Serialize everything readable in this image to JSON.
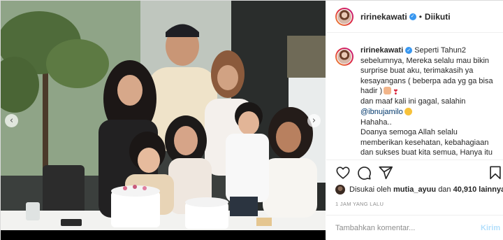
{
  "header": {
    "username": "ririnekawati",
    "separator": "•",
    "follow_status": "Diikuti"
  },
  "caption": {
    "username": "ririnekawati",
    "lines": [
      "Seperti Tahun2",
      "sebelumnya, Mereka selalu mau bikin",
      "surprise buat aku, terimakasih ya",
      "kesayangans ( beberpa ada yg ga bisa",
      "hadir )",
      "dan maaf kali ini gagal, salahin",
      "@ibnujamilo",
      "Hahaha..",
      "Doanya semoga Allah selalu",
      "memberikan kesehatan, kebahagiaan",
      "dan sukses buat kita semua, Hanya itu"
    ]
  },
  "likes": {
    "prefix": "Disukai oleh",
    "user": "mutia_ayuu",
    "connector": "dan",
    "count": "40,910 lainnya"
  },
  "timestamp": "1 JAM YANG LALU",
  "comment": {
    "placeholder": "Tambahkan komentar...",
    "post_label": "Kirim"
  },
  "icons": {
    "prev": "chevron-left-icon",
    "next": "chevron-right-icon",
    "like": "heart-icon",
    "comment": "comment-icon",
    "share": "paper-plane-icon",
    "save": "bookmark-icon",
    "verified": "verified-badge-icon"
  },
  "colors": {
    "verified": "#3897f0",
    "mention": "#00376b",
    "muted": "#8e8e8e",
    "post_button": "#b2dffc"
  }
}
